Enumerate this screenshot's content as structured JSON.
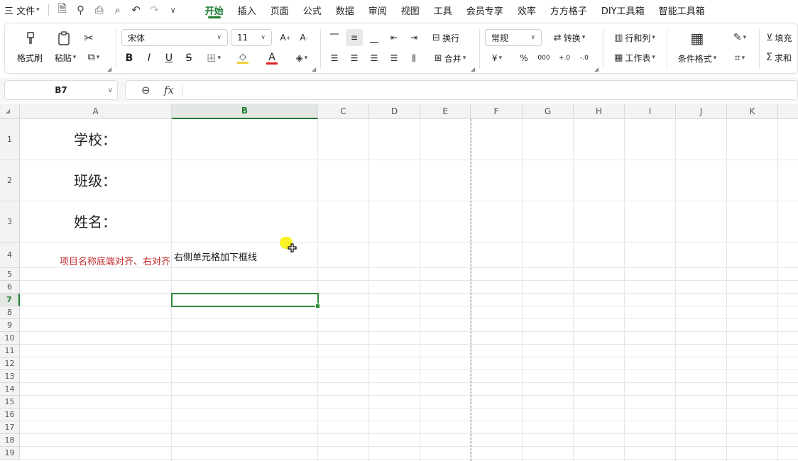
{
  "menubar": {
    "file_menu": "三 文件",
    "tabs": [
      "开始",
      "插入",
      "页面",
      "公式",
      "数据",
      "审阅",
      "视图",
      "工具",
      "会员专享",
      "效率",
      "方方格子",
      "DIY工具箱",
      "智能工具箱"
    ],
    "active_tab": "开始"
  },
  "ribbon": {
    "format_painter": "格式刷",
    "paste": "粘贴",
    "font_name": "宋体",
    "font_size": "11",
    "wrap": "换行",
    "merge": "合并",
    "number_format": "常规",
    "convert": "转换",
    "rows_cols": "行和列",
    "worksheet": "工作表",
    "cond_format": "条件格式",
    "fill": "填充",
    "sum": "求和",
    "bold": "B",
    "italic": "I",
    "underline": "U",
    "strike": "S",
    "currency": "¥",
    "percent": "%",
    "thousands": "000",
    "dec_inc": "+.0",
    "dec_dec": "-.0"
  },
  "formula_bar": {
    "name_box": "B7",
    "fx": "fx",
    "content": ""
  },
  "columns": [
    "A",
    "B",
    "C",
    "D",
    "E",
    "F",
    "G",
    "H",
    "I",
    "J",
    "K"
  ],
  "selected_column": "B",
  "rows": [
    "1",
    "2",
    "3",
    "4",
    "5",
    "6",
    "7",
    "8",
    "9",
    "10",
    "11",
    "12",
    "13",
    "14",
    "15",
    "16",
    "17",
    "18",
    "19"
  ],
  "selected_row": "7",
  "cells": {
    "A1": "学校：",
    "A2": "班级：",
    "A3": "姓名：",
    "A4": "项目名称底端对齐、右对齐",
    "B4": "右侧单元格加下框线"
  },
  "colors": {
    "accent": "#1e7d32",
    "a4_text": "#c0282c",
    "selection": "#2f8a3a",
    "font_color_bar": "#e02020",
    "highlight_bar": "#f4d03f",
    "cursor_highlight": "#f7f000"
  }
}
